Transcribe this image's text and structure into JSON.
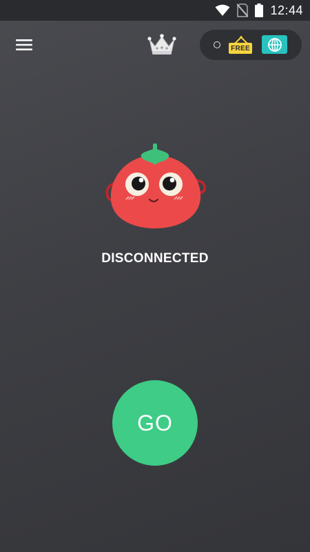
{
  "status_bar": {
    "time": "12:44",
    "icons": [
      "wifi-icon",
      "no-sim-icon",
      "battery-icon"
    ]
  },
  "header": {
    "menu_icon": "hamburger-menu-icon",
    "premium_icon": "crown-icon",
    "free_badge_label": "FREE",
    "location_icon": "globe-icon"
  },
  "main": {
    "mascot": "tomato-mascot",
    "connection_status": "DISCONNECTED",
    "go_label": "GO"
  },
  "colors": {
    "background": "#3f4045",
    "status_bar": "#2a2b2f",
    "go_button": "#3ecc87",
    "free_badge": "#f6d43f",
    "globe_button": "#28c3bf",
    "mascot_red": "#ec4a4a",
    "mascot_leaf": "#3ec07a"
  }
}
